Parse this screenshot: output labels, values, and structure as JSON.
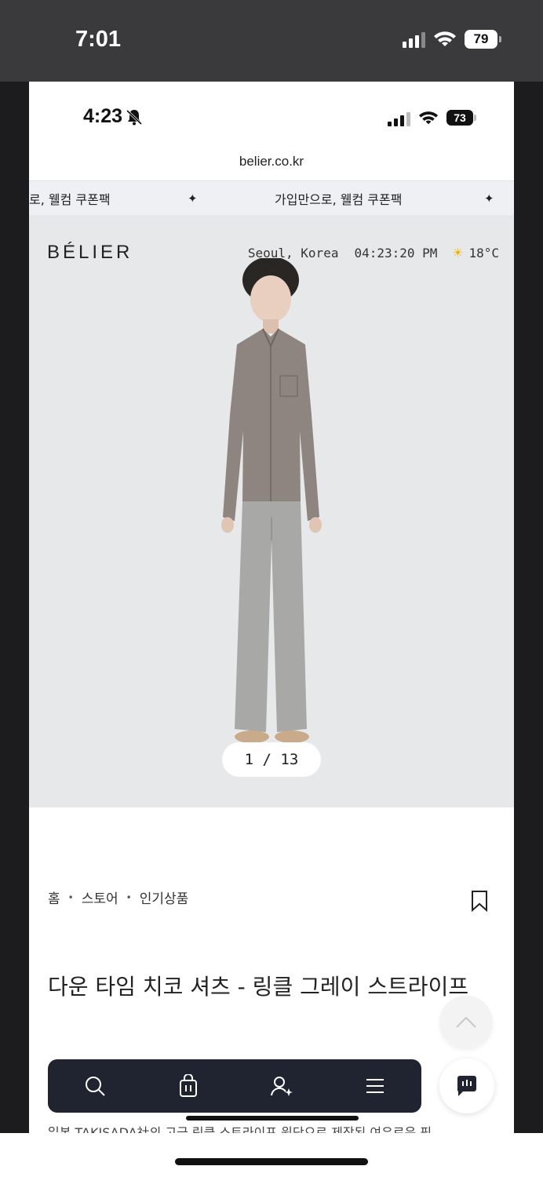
{
  "outer_status": {
    "time": "7:01",
    "battery": "79"
  },
  "inner_status": {
    "time": "4:23",
    "battery": "73"
  },
  "url": "belier.co.kr",
  "marquee": {
    "left_text": "로, 웰컴 쿠폰팩",
    "right_text": "가입만으로, 웰컴 쿠폰팩"
  },
  "header": {
    "logo": "BÉLIER",
    "location": "Seoul, Korea",
    "clock": "04:23:20 PM",
    "temperature": "18°C"
  },
  "gallery": {
    "pager": "1 / 13"
  },
  "breadcrumb": [
    "홈",
    "스토어",
    "인기상품"
  ],
  "product": {
    "title": "다운 타임 치코 셔츠 - 링클 그레이 스트라이프"
  },
  "description_preview": "일본 TAKISADA社의 고급 링클 스트라이프 원단으로 제작된 여유로운 핏"
}
